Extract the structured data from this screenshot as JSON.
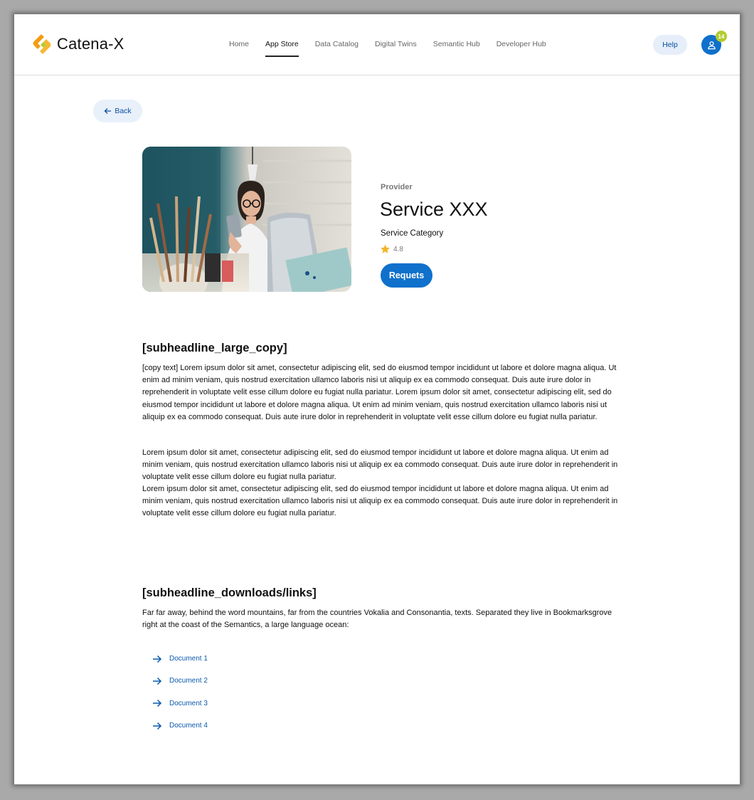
{
  "app": {
    "brand": "Catena-X",
    "brand_colors": {
      "orange": "#f39c12",
      "green": "#b3cb2d",
      "primary": "#0f71cb"
    }
  },
  "nav": {
    "items": [
      {
        "label": "Home"
      },
      {
        "label": "App Store",
        "active": true
      },
      {
        "label": "Data Catalog"
      },
      {
        "label": "Digital Twins"
      },
      {
        "label": "Semantic Hub"
      },
      {
        "label": "Developer Hub"
      }
    ]
  },
  "header": {
    "help_label": "Help",
    "notification_count": "14",
    "user_icon": "user-icon"
  },
  "back": {
    "label": "Back",
    "icon": "arrow-left-icon"
  },
  "service": {
    "provider": "Provider",
    "title": "Service XXX",
    "category": "Service Category",
    "rating": "4.8",
    "rating_icon": "star-icon",
    "request_label": "Requets"
  },
  "copy": {
    "heading": "[subheadline_large_copy]",
    "paragraph_1": "[copy text] Lorem ipsum dolor sit amet, consectetur adipiscing elit, sed do eiusmod tempor incididunt ut labore et dolore magna aliqua. Ut enim ad minim veniam, quis nostrud exercitation ullamco laboris nisi ut aliquip ex ea commodo consequat. Duis aute irure dolor in reprehenderit in voluptate velit esse cillum dolore eu fugiat nulla pariatur. Lorem ipsum dolor sit amet, consectetur adipiscing elit, sed do eiusmod tempor incididunt ut labore et dolore magna aliqua. Ut enim ad minim veniam, quis nostrud exercitation ullamco laboris nisi ut aliquip ex ea commodo consequat. Duis aute irure dolor in reprehenderit in voluptate velit esse cillum dolore eu fugiat nulla pariatur.",
    "paragraph_2": "Lorem ipsum dolor sit amet, consectetur adipiscing elit, sed do eiusmod tempor incididunt ut labore et dolore magna aliqua. Ut enim ad minim veniam, quis nostrud exercitation ullamco laboris nisi ut aliquip ex ea commodo consequat. Duis aute irure dolor in reprehenderit in voluptate velit esse cillum dolore eu fugiat nulla pariatur.",
    "paragraph_3": "Lorem ipsum dolor sit amet, consectetur adipiscing elit, sed do eiusmod tempor incididunt ut labore et dolore magna aliqua. Ut enim ad minim veniam, quis nostrud exercitation ullamco laboris nisi ut aliquip ex ea commodo consequat. Duis aute irure dolor in reprehenderit in voluptate velit esse cillum dolore eu fugiat nulla pariatur."
  },
  "downloads": {
    "heading": "[subheadline_downloads/links]",
    "intro": "Far far away, behind the word mountains, far from the countries Vokalia and Consonantia, texts. Separated they live in Bookmarksgrove right at the coast of the Semantics, a large language ocean:",
    "items": [
      {
        "label": "Document 1",
        "icon": "arrow-right-icon"
      },
      {
        "label": "Document 2",
        "icon": "arrow-right-icon"
      },
      {
        "label": "Document 3",
        "icon": "arrow-right-icon"
      },
      {
        "label": "Document 4",
        "icon": "arrow-right-icon"
      }
    ]
  }
}
